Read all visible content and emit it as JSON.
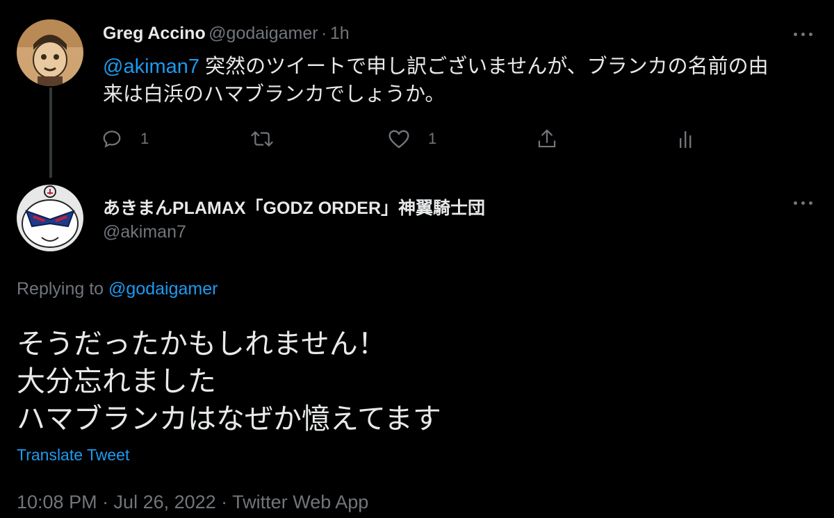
{
  "parent_tweet": {
    "author_name": "Greg Accino",
    "handle": "@godaigamer",
    "separator": "·",
    "time_ago": "1h",
    "mention": "@akiman7",
    "text_line1": " 突然のツイートで申し訳ございませんが、ブランカの名前の由",
    "text_line2": "来は白浜のハマブランカでしょうか。",
    "actions": {
      "reply_count": "1",
      "like_count": "1"
    }
  },
  "main_tweet": {
    "author_name": "あきまんPLAMAX「GODZ ORDER」神翼騎士団",
    "handle": "@akiman7",
    "replying_prefix": "Replying to ",
    "replying_to": "@godaigamer",
    "text_lines": [
      "そうだったかもしれません！",
      "大分忘れました",
      "ハマブランカはなぜか憶えてます"
    ],
    "translate_label": "Translate Tweet",
    "timestamp": "10:08 PM · Jul 26, 2022 · Twitter Web App"
  },
  "colors": {
    "background": "#000000",
    "text": "#e7e9ea",
    "secondary": "#71767b",
    "accent": "#1d9bf0"
  },
  "icons": [
    "reply-icon",
    "retweet-icon",
    "like-icon",
    "share-icon",
    "analytics-icon",
    "more-icon"
  ]
}
